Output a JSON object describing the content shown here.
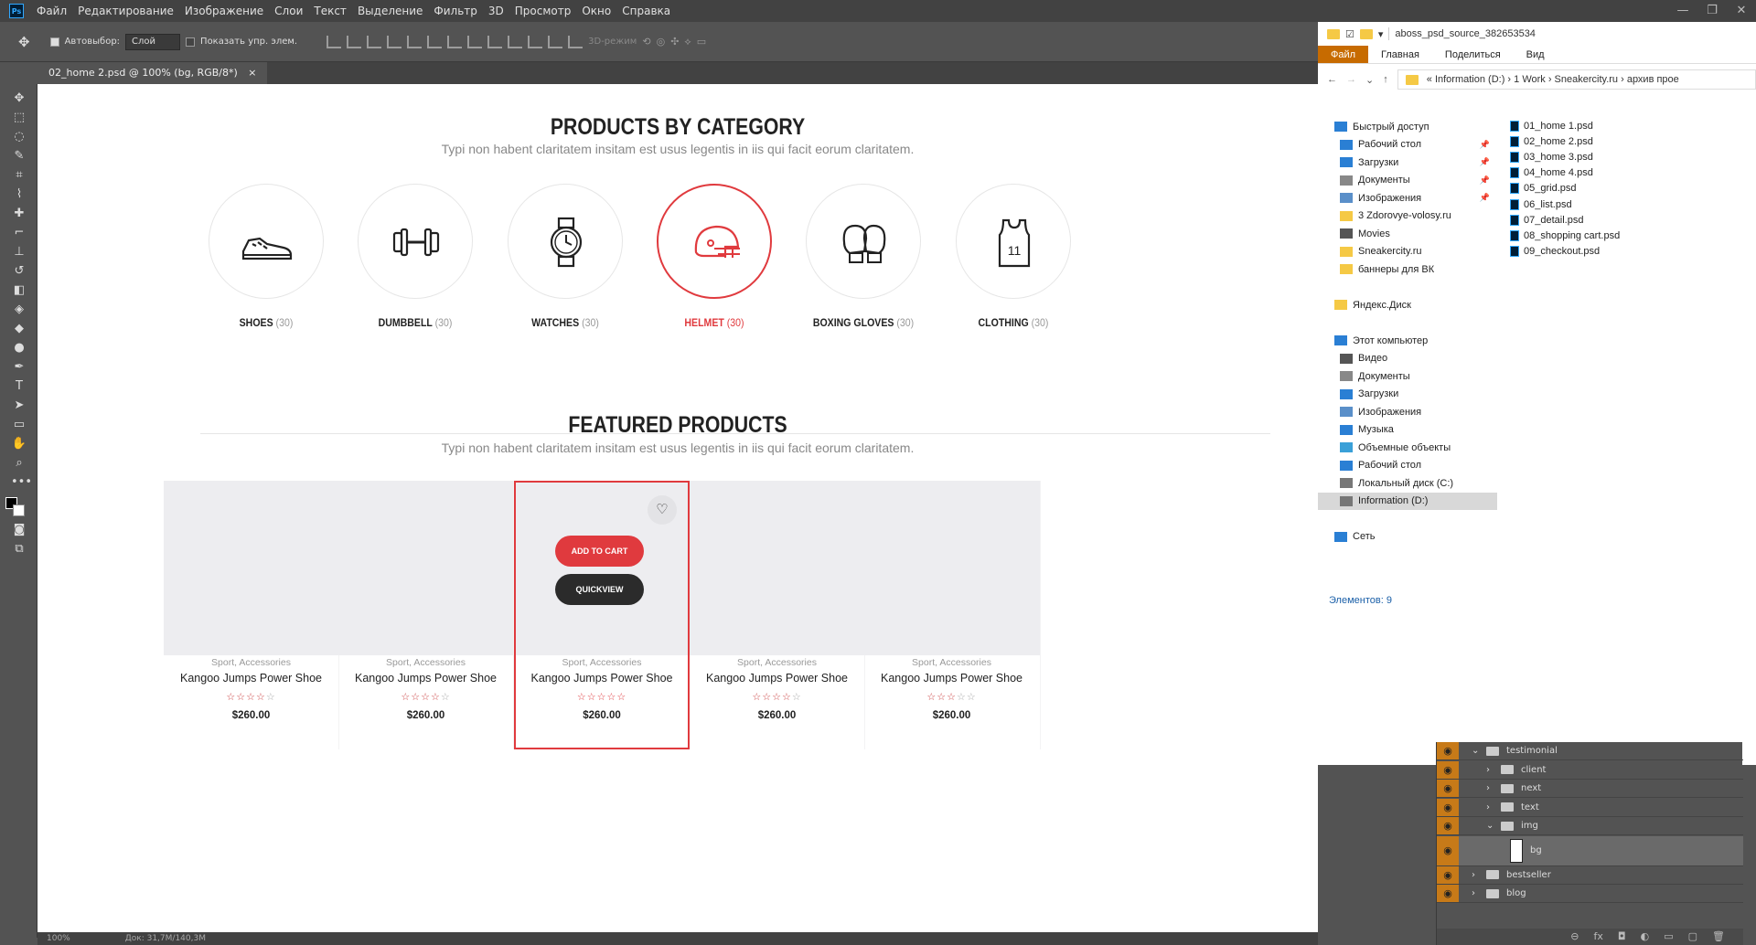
{
  "photoshop": {
    "logo": "Ps",
    "menu": [
      "Файл",
      "Редактирование",
      "Изображение",
      "Слои",
      "Текст",
      "Выделение",
      "Фильтр",
      "3D",
      "Просмотр",
      "Окно",
      "Справка"
    ],
    "options": {
      "autoselect_label": "Автовыбор:",
      "layer_select": "Слой",
      "show_controls_label": "Показать упр. элем.",
      "mode_3d": "3D-режим"
    },
    "doc_tab": "02_home 2.psd @ 100% (bg, RGB/8*)",
    "doc_tab_close": "×",
    "status": {
      "zoom": "100%",
      "doc_size": "Док: 31,7M/140,3M"
    }
  },
  "canvas": {
    "category_section": {
      "title": "PRODUCTS BY CATEGORY",
      "subtitle": "Typi non habent claritatem insitam est usus legentis in iis qui facit eorum claritatem.",
      "items": [
        {
          "icon": "shoe-icon",
          "label": "SHOES",
          "count": "(30)"
        },
        {
          "icon": "dumbbell-icon",
          "label": "DUMBBELL",
          "count": "(30)"
        },
        {
          "icon": "watch-icon",
          "label": "WATCHES",
          "count": "(30)"
        },
        {
          "icon": "helmet-icon",
          "label": "HELMET",
          "count": "(30)",
          "active": true
        },
        {
          "icon": "boxing-gloves-icon",
          "label": "BOXING GLOVES",
          "count": "(30)"
        },
        {
          "icon": "jersey-icon",
          "label": "CLOTHING",
          "count": "(30)"
        }
      ]
    },
    "featured_section": {
      "title": "FEATURED PRODUCTS",
      "subtitle": "Typi non habent claritatem insitam est usus legentis in iis qui facit eorum claritatem.",
      "products": [
        {
          "category": "Sport, Accessories",
          "name": "Kangoo Jumps Power Shoe",
          "rating": 4,
          "max_rating": 5,
          "price": "$260.00"
        },
        {
          "category": "Sport, Accessories",
          "name": "Kangoo Jumps Power Shoe",
          "rating": 4,
          "max_rating": 5,
          "price": "$260.00"
        },
        {
          "category": "Sport, Accessories",
          "name": "Kangoo Jumps Power Shoe",
          "rating": 5,
          "max_rating": 5,
          "price": "$260.00",
          "active": true
        },
        {
          "category": "Sport, Accessories",
          "name": "Kangoo Jumps Power Shoe",
          "rating": 4,
          "max_rating": 5,
          "price": "$260.00"
        },
        {
          "category": "Sport, Accessories",
          "name": "Kangoo Jumps Power Shoe",
          "rating": 3,
          "max_rating": 5,
          "price": "$260.00"
        }
      ],
      "add_to_cart": "ADD TO CART",
      "quickview": "QUICKVIEW"
    },
    "accent_color": "#e03a3e"
  },
  "explorer": {
    "title": "aboss_psd_source_382653534",
    "ribbon": [
      "Файл",
      "Главная",
      "Поделиться",
      "Вид"
    ],
    "path": "«  Information (D:)  ›  1 Work  ›  Sneakercity.ru  ›  архив прое",
    "nav": [
      {
        "label": "Быстрый доступ",
        "icon": "star-icon",
        "indent": 0
      },
      {
        "label": "Рабочий стол",
        "icon": "desktop-icon",
        "indent": 1,
        "pinned": true
      },
      {
        "label": "Загрузки",
        "icon": "download-icon",
        "indent": 1,
        "pinned": true
      },
      {
        "label": "Документы",
        "icon": "documents-icon",
        "indent": 1,
        "pinned": true
      },
      {
        "label": "Изображения",
        "icon": "images-icon",
        "indent": 1,
        "pinned": true
      },
      {
        "label": "3 Zdorovye-volosy.ru",
        "icon": "folder-icon",
        "indent": 1
      },
      {
        "label": "Movies",
        "icon": "movies-icon",
        "indent": 1
      },
      {
        "label": "Sneakercity.ru",
        "icon": "folder-icon",
        "indent": 1
      },
      {
        "label": "баннеры для ВК",
        "icon": "folder-icon",
        "indent": 1
      },
      {
        "label": "",
        "icon": "",
        "indent": 0
      },
      {
        "label": "Яндекс.Диск",
        "icon": "folder-icon",
        "indent": 0
      },
      {
        "label": "",
        "icon": "",
        "indent": 0
      },
      {
        "label": "Этот компьютер",
        "icon": "computer-icon",
        "indent": 0
      },
      {
        "label": "Видео",
        "icon": "video-icon",
        "indent": 1
      },
      {
        "label": "Документы",
        "icon": "documents-icon",
        "indent": 1
      },
      {
        "label": "Загрузки",
        "icon": "download-icon",
        "indent": 1
      },
      {
        "label": "Изображения",
        "icon": "images-icon",
        "indent": 1
      },
      {
        "label": "Музыка",
        "icon": "music-icon",
        "indent": 1
      },
      {
        "label": "Объемные объекты",
        "icon": "cube-icon",
        "indent": 1
      },
      {
        "label": "Рабочий стол",
        "icon": "desktop-icon",
        "indent": 1
      },
      {
        "label": "Локальный диск (C:)",
        "icon": "drive-icon",
        "indent": 1
      },
      {
        "label": "Information (D:)",
        "icon": "drive-icon",
        "indent": 1,
        "selected": true
      },
      {
        "label": "",
        "icon": "",
        "indent": 0
      },
      {
        "label": "Сеть",
        "icon": "network-icon",
        "indent": 0
      }
    ],
    "files": [
      "01_home  1.psd",
      "02_home 2.psd",
      "03_home 3.psd",
      "04_home 4.psd",
      "05_grid.psd",
      "06_list.psd",
      "07_detail.psd",
      "08_shopping cart.psd",
      "09_checkout.psd"
    ],
    "status": "Элементов: 9"
  },
  "layers": [
    {
      "name": "testimonial",
      "type": "group",
      "expanded": true
    },
    {
      "name": "client",
      "type": "group"
    },
    {
      "name": "next",
      "type": "group"
    },
    {
      "name": "text",
      "type": "group"
    },
    {
      "name": "img",
      "type": "group",
      "expanded": true
    },
    {
      "name": "bg",
      "type": "layer",
      "selected": true
    },
    {
      "name": "bestseller",
      "type": "group"
    },
    {
      "name": "blog",
      "type": "group"
    }
  ],
  "layers_footer": [
    "⊖",
    "fx",
    "◘",
    "◐",
    "▭",
    "▢",
    "🗑"
  ]
}
